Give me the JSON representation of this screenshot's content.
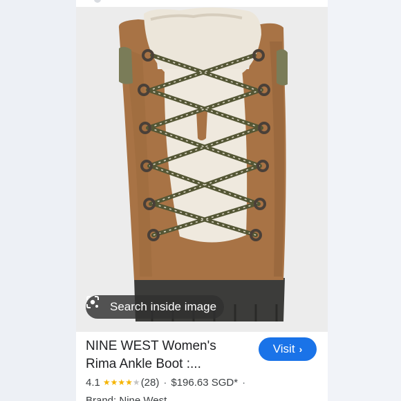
{
  "lens": {
    "label": "Search inside image",
    "icon": "lens-search-icon"
  },
  "product": {
    "title_line1": "NINE WEST Women's",
    "title_line2": "Rima Ankle Boot :...",
    "rating_value": "4.1",
    "rating_stars": 4.1,
    "review_count": "(28)",
    "price": "$196.63 SGD*",
    "dot_separator": "·",
    "brand_partial": "Brand: Nine West"
  },
  "visit": {
    "label": "Visit",
    "icon": "chevron-right-icon"
  },
  "colors": {
    "accent": "#1a73e8",
    "star": "#f5b400",
    "boot_suede": "#a87345",
    "shearling": "#ece6da",
    "sole": "#3c3c3a"
  }
}
